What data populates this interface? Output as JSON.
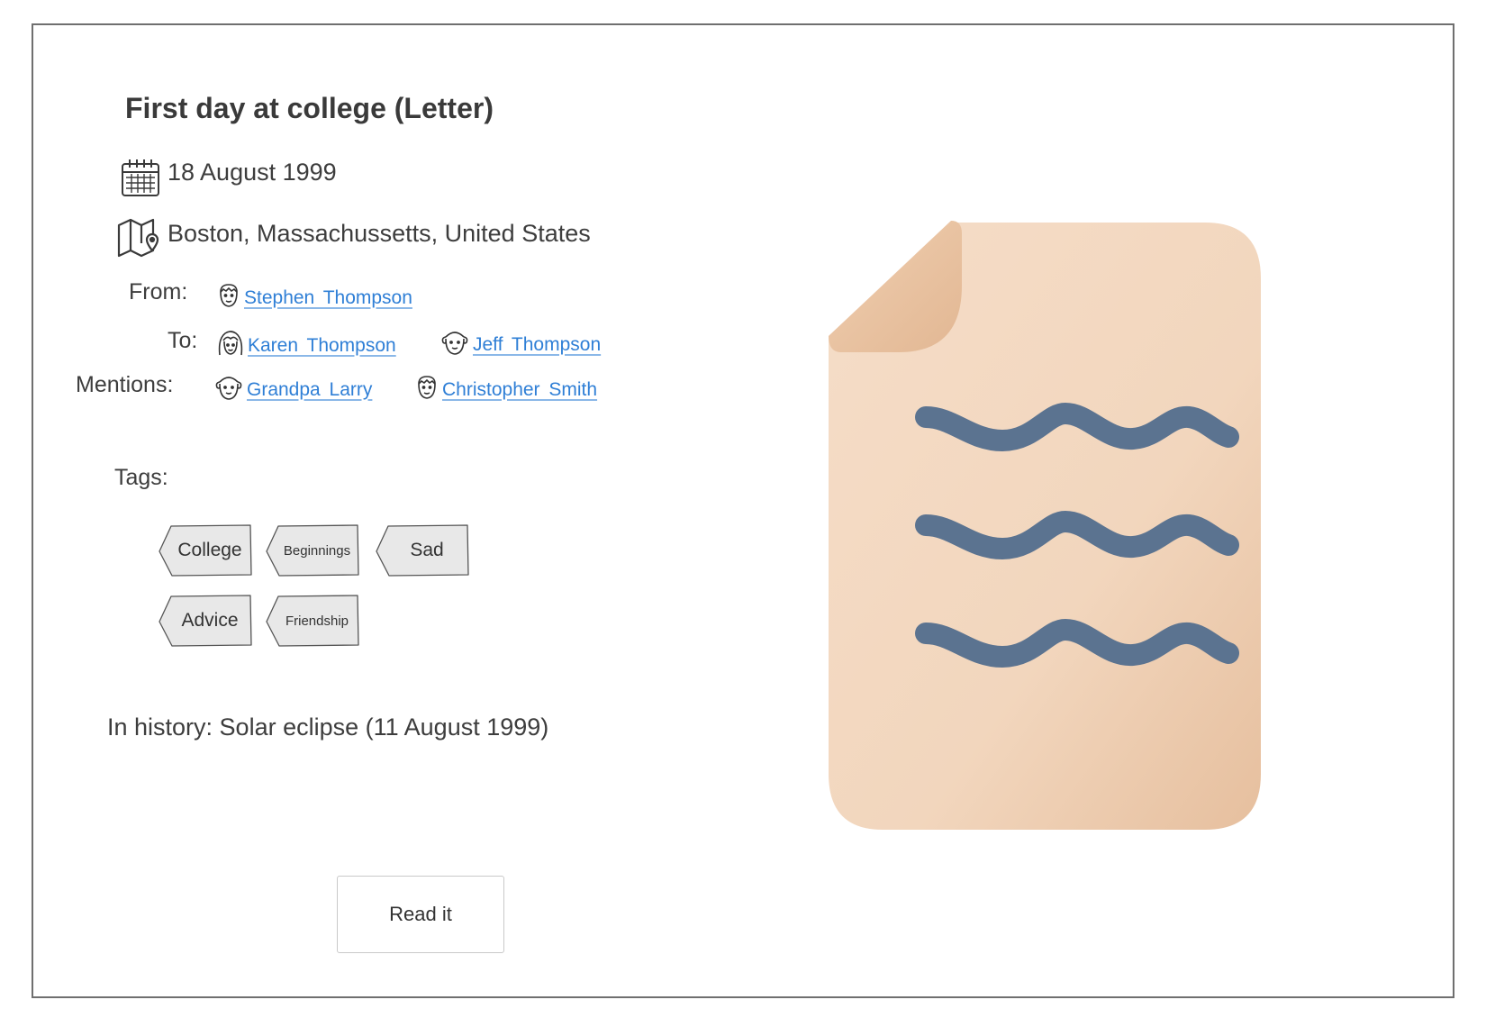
{
  "document": {
    "title": "First day at college (Letter)",
    "date": "18 August 1999",
    "location": "Boston, Massachussetts, United States"
  },
  "people": {
    "from_label": "From:",
    "to_label": "To:",
    "mentions_label": "Mentions:",
    "from": [
      {
        "name": "Stephen Thompson",
        "icon": "man-face-icon"
      }
    ],
    "to": [
      {
        "name": "Karen Thompson",
        "icon": "woman-face-icon"
      },
      {
        "name": "Jeff Thompson",
        "icon": "boy-face-icon"
      }
    ],
    "mentions": [
      {
        "name": "Grandpa Larry",
        "icon": "boy-face-icon"
      },
      {
        "name": "Christopher Smith",
        "icon": "man-face-icon"
      }
    ]
  },
  "tags": {
    "label": "Tags:",
    "items": [
      "College",
      "Beginnings",
      "Sad",
      "Advice",
      "Friendship"
    ]
  },
  "history": {
    "text": "In history: Solar eclipse (11 August 1999)"
  },
  "actions": {
    "read_label": "Read it"
  },
  "preview": {
    "icon": "document-icon",
    "paper_color": "#f3d9c2",
    "line_color": "#5b7390"
  }
}
